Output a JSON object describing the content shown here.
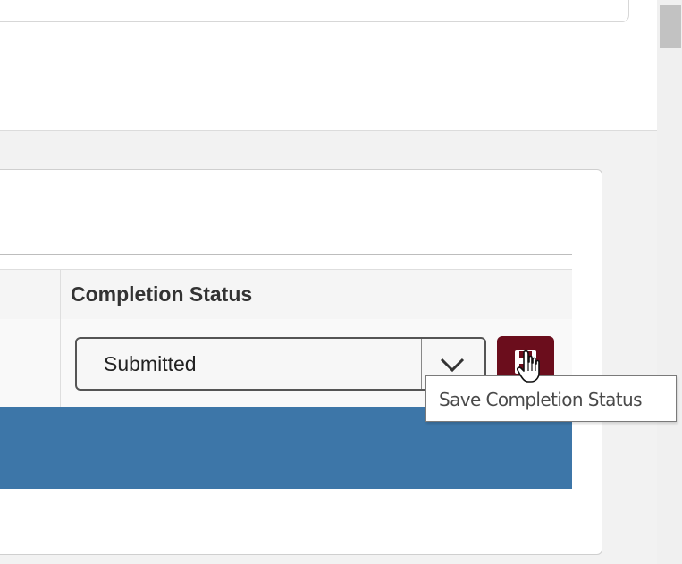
{
  "table": {
    "header": {
      "completion_status": "Completion Status"
    },
    "row": {
      "status_value": "Submitted"
    }
  },
  "save_button": {
    "icon": "save-icon",
    "tooltip": "Save Completion Status"
  },
  "icons": {
    "dropdown": "chevron-down-icon",
    "cursor": "hand-pointer-cursor"
  },
  "colors": {
    "save_button_bg": "#6b0d1c",
    "banner_blue": "#3d76a8"
  }
}
